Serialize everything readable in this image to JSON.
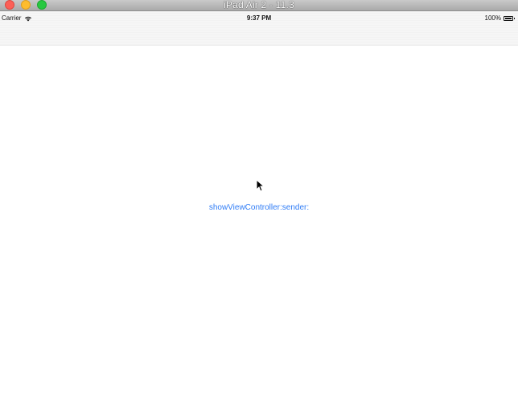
{
  "window": {
    "title": "iPad Air 2 - 11.3"
  },
  "status_bar": {
    "carrier": "Carrier",
    "time": "9:37 PM",
    "battery_percent": "100%",
    "battery_level": 1.0
  },
  "main": {
    "button_label": "showViewController:sender:"
  },
  "colors": {
    "accent": "#2f7cf6",
    "close": "#fc5f57",
    "minimize": "#fdbc2e",
    "zoom": "#28c840"
  }
}
